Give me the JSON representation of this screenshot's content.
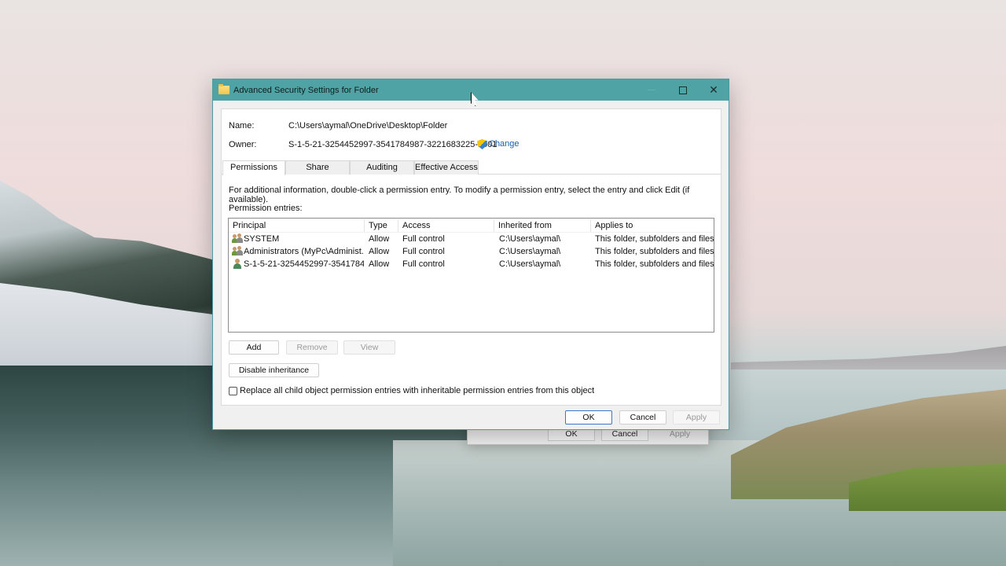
{
  "window": {
    "title": "Advanced Security Settings for Folder",
    "name_label": "Name:",
    "name_value": "C:\\Users\\aymal\\OneDrive\\Desktop\\Folder",
    "owner_label": "Owner:",
    "owner_value": "S-1-5-21-3254452997-3541784987-3221683225-1001",
    "change_link": "Change",
    "close_glyph": "✕"
  },
  "tabs": [
    "Permissions",
    "Share",
    "Auditing",
    "Effective Access"
  ],
  "info_text": "For additional information, double-click a permission entry. To modify a permission entry, select the entry and click Edit (if available).",
  "permission_entries_label": "Permission entries:",
  "columns": [
    "Principal",
    "Type",
    "Access",
    "Inherited from",
    "Applies to"
  ],
  "entries": [
    {
      "principal": "SYSTEM",
      "type": "Allow",
      "access": "Full control",
      "inherited_from": "C:\\Users\\aymal\\",
      "applies_to": "This folder, subfolders and files"
    },
    {
      "principal": "Administrators (MyPc\\Administ...",
      "type": "Allow",
      "access": "Full control",
      "inherited_from": "C:\\Users\\aymal\\",
      "applies_to": "This folder, subfolders and files"
    },
    {
      "principal": "S-1-5-21-3254452997-35417849...",
      "type": "Allow",
      "access": "Full control",
      "inherited_from": "C:\\Users\\aymal\\",
      "applies_to": "This folder, subfolders and files"
    }
  ],
  "buttons": {
    "add": "Add",
    "remove": "Remove",
    "view": "View",
    "disable_inheritance": "Disable inheritance",
    "ok": "OK",
    "cancel": "Cancel",
    "apply": "Apply"
  },
  "replace_checkbox": {
    "label": "Replace all child object permission entries with inheritable permission entries from this object",
    "checked": false
  },
  "background_dialog": {
    "ok": "OK",
    "cancel": "Cancel",
    "apply": "Apply"
  },
  "colors": {
    "titlebar": "#4fa3a4",
    "ok_border": "#3a78c4",
    "link": "#1d5fa9"
  }
}
